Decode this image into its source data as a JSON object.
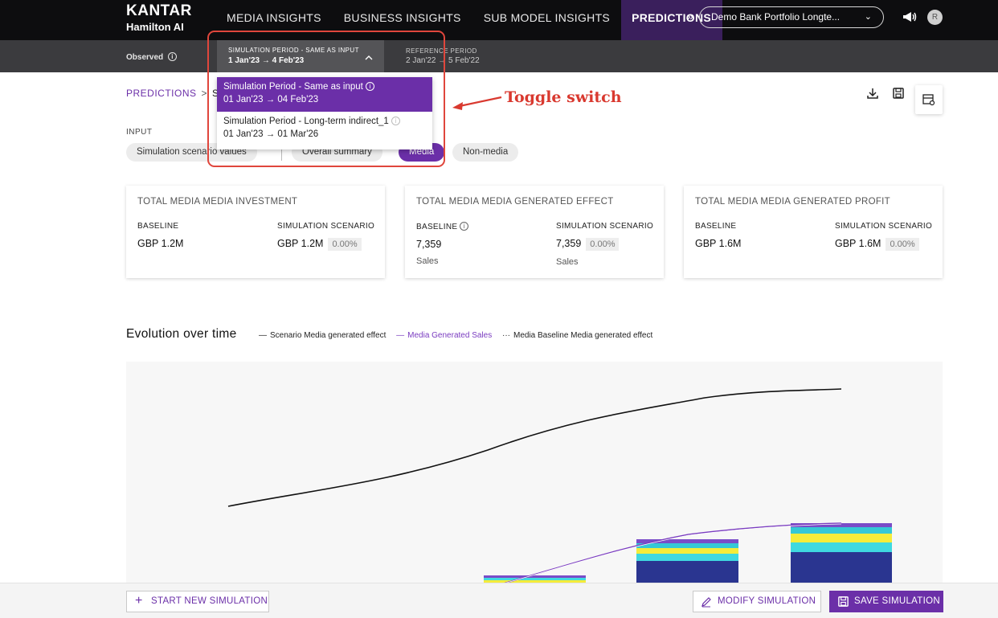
{
  "app": {
    "brand_line1": "KANTAR",
    "brand_line2": "Hamilton AI"
  },
  "nav": {
    "items": [
      {
        "label": "MEDIA INSIGHTS"
      },
      {
        "label": "BUSINESS INSIGHTS"
      },
      {
        "label": "SUB MODEL INSIGHTS"
      },
      {
        "label": "PREDICTIONS"
      }
    ],
    "more_icon": "»",
    "portfolio_select": "Demo Bank Portfolio Longte...",
    "portfolio_chevron": "⌄",
    "avatar_initial": "R"
  },
  "subbar": {
    "observed_label": "Observed",
    "simulation_period_title": "SIMULATION PERIOD - SAME AS INPUT",
    "simulation_period_value": "1 Jan'23 → 4 Feb'23",
    "reference_period_title": "REFERENCE PERIOD",
    "reference_period_value": "2 Jan'22 → 5 Feb'22"
  },
  "breadcrumb": {
    "root": "PREDICTIONS",
    "separator": ">",
    "current": "SI"
  },
  "dropdown": {
    "options": [
      {
        "title": "Simulation Period - Same as input",
        "dates": "01 Jan'23 → 04 Feb'23"
      },
      {
        "title": "Simulation Period - Long-term indirect_1",
        "dates": "01 Jan'23 → 01 Mar'26"
      }
    ]
  },
  "input_section": {
    "label": "INPUT",
    "chips": [
      "Simulation scenario values",
      "Overall summary",
      "Media",
      "Non-media"
    ]
  },
  "cards": [
    {
      "title": "TOTAL MEDIA MEDIA INVESTMENT",
      "baseline_label": "BASELINE",
      "baseline_value": "GBP 1.2M",
      "scenario_label": "SIMULATION SCENARIO",
      "scenario_value": "GBP 1.2M",
      "scenario_pct": "0.00%"
    },
    {
      "title": "TOTAL MEDIA MEDIA GENERATED EFFECT",
      "baseline_label": "BASELINE",
      "baseline_value": "7,359",
      "baseline_unit": "Sales",
      "scenario_label": "SIMULATION SCENARIO",
      "scenario_value": "7,359",
      "scenario_pct": "0.00%",
      "scenario_unit": "Sales"
    },
    {
      "title": "TOTAL MEDIA MEDIA GENERATED PROFIT",
      "baseline_label": "BASELINE",
      "baseline_value": "GBP 1.6M",
      "scenario_label": "SIMULATION SCENARIO",
      "scenario_value": "GBP 1.6M",
      "scenario_pct": "0.00%"
    }
  ],
  "evolution": {
    "title": "Evolution over time",
    "legend": [
      {
        "symbol": "—",
        "label": "Scenario Media generated effect"
      },
      {
        "symbol": "—",
        "label": "Media Generated Sales"
      },
      {
        "symbol": "···",
        "label": "Media Baseline Media generated effect"
      }
    ]
  },
  "chart_data": {
    "type": "bar",
    "series": [
      {
        "name": "Scenario Media generated effect"
      },
      {
        "name": "Media Generated Sales"
      },
      {
        "name": "Media Baseline Media generated effect"
      }
    ],
    "colors": {
      "scenario_line": "#111111",
      "sales_line": "#7a3cc0",
      "stack": [
        "#2a3590",
        "#3fd9e0",
        "#f5ec3a",
        "#35c8d6",
        "#7a4cc8"
      ]
    },
    "grid": false,
    "legend_position": "top"
  },
  "buttons": {
    "start_new": "START NEW SIMULATION",
    "modify": "MODIFY SIMULATION",
    "save": "SAVE SIMULATION"
  },
  "annotation": {
    "text": "Toggle switch"
  },
  "colors": {
    "accent": "#6b2fa8",
    "topbar": "#0d0d0f",
    "annotation": "#e0463c"
  }
}
